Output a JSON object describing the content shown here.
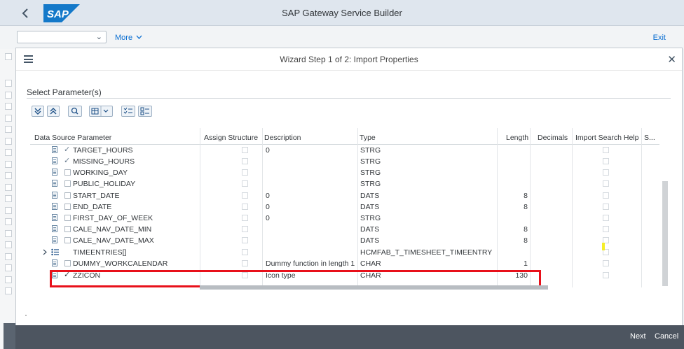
{
  "shell": {
    "title": "SAP Gateway Service Builder",
    "logo_text": "SAP",
    "brand_color": "#0a6ed1"
  },
  "subbar": {
    "combo_value": "",
    "more_label": "More",
    "exit_label": "Exit"
  },
  "dialog": {
    "title": "Wizard Step 1 of 2: Import Properties",
    "section_title": "Select Parameter(s)",
    "toolbar_icons": [
      "expand-all-icon",
      "collapse-all-icon",
      "find-icon",
      "layout-icon",
      "select-all-icon",
      "deselect-all-icon"
    ]
  },
  "table": {
    "columns": [
      "Data Source Parameter",
      "Assign Structure",
      "Description",
      "Type",
      "Length",
      "Decimals",
      "Import Search Help",
      "S..."
    ],
    "rows": [
      {
        "name": "TARGET_HOURS",
        "checked": true,
        "description": "0",
        "type": "STRG",
        "length": ""
      },
      {
        "name": "MISSING_HOURS",
        "checked": true,
        "description": "",
        "type": "STRG",
        "length": ""
      },
      {
        "name": "WORKING_DAY",
        "checked": false,
        "description": "",
        "type": "STRG",
        "length": ""
      },
      {
        "name": "PUBLIC_HOLIDAY",
        "checked": false,
        "description": "",
        "type": "STRG",
        "length": ""
      },
      {
        "name": "START_DATE",
        "checked": false,
        "description": "0",
        "type": "DATS",
        "length": "8"
      },
      {
        "name": "END_DATE",
        "checked": false,
        "description": "0",
        "type": "DATS",
        "length": "8"
      },
      {
        "name": "FIRST_DAY_OF_WEEK",
        "checked": false,
        "description": "0",
        "type": "STRG",
        "length": ""
      },
      {
        "name": "CALE_NAV_DATE_MIN",
        "checked": false,
        "description": "",
        "type": "DATS",
        "length": "8"
      },
      {
        "name": "CALE_NAV_DATE_MAX",
        "checked": false,
        "description": "",
        "type": "DATS",
        "length": "8"
      },
      {
        "name": "TIMEENTRIES[]",
        "checked": false,
        "description": "",
        "type": "HCMFAB_T_TIMESHEET_TIMEENTRY",
        "length": ""
      },
      {
        "name": "DUMMY_WORKCALENDAR",
        "checked": false,
        "description": "Dummy function in length 1",
        "type": "CHAR",
        "length": "1"
      },
      {
        "name": "ZZICON",
        "checked": true,
        "description": "Icon type",
        "type": "CHAR",
        "length": "130"
      }
    ]
  },
  "footer": {
    "next_label": "Next",
    "cancel_label": "Cancel"
  }
}
